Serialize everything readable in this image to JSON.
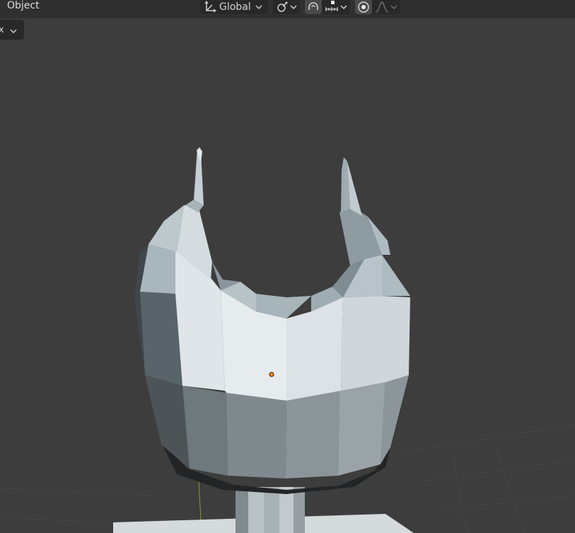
{
  "header": {
    "mode_label": "Object",
    "transform_orientation": {
      "label": "Global",
      "icon": "transform-axes-icon"
    },
    "pivot_point": {
      "icon": "pivot-link-icon"
    },
    "snap": {
      "icon": "magnet-icon",
      "target_icon": "snap-increment-icon"
    },
    "proportional_editing": {
      "icon": "proportional-circle-icon",
      "falloff_icon": "falloff-curve-icon"
    }
  },
  "side_menu": {
    "label": "x"
  },
  "colors": {
    "viewport_bg": "#3d3d3d",
    "header_bg": "#303030",
    "button_bg": "#282828",
    "origin_dot": "#f08a24",
    "mesh_light": "#dde3e6",
    "mesh_shadow": "#5a6468"
  }
}
